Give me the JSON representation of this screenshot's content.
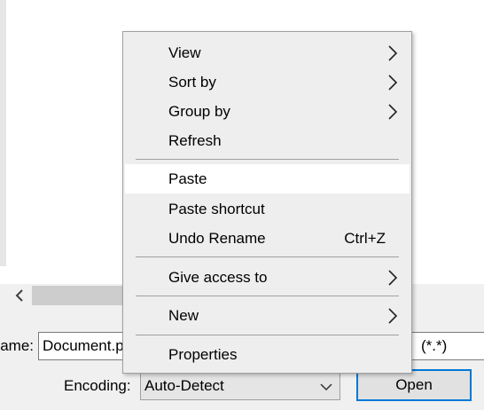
{
  "dialog": {
    "filename_label": "ame:",
    "filename_value": "Document.p",
    "filetype_value": "(*.*)",
    "encoding_label": "Encoding:",
    "encoding_value": "Auto-Detect",
    "open_label": "Open"
  },
  "context_menu": {
    "items": [
      {
        "label": "View",
        "submenu": true
      },
      {
        "label": "Sort by",
        "submenu": true
      },
      {
        "label": "Group by",
        "submenu": true
      },
      {
        "label": "Refresh"
      },
      {
        "label": "Paste",
        "highlighted": true
      },
      {
        "label": "Paste shortcut"
      },
      {
        "label": "Undo Rename",
        "shortcut": "Ctrl+Z"
      },
      {
        "label": "Give access to",
        "submenu": true
      },
      {
        "label": "New",
        "submenu": true
      },
      {
        "label": "Properties"
      }
    ]
  },
  "icons": {
    "submenu": "chevron-right-icon",
    "scroll_left": "chevron-left-icon",
    "dropdown": "chevron-down-icon"
  },
  "colors": {
    "menu_background": "#eeeeee",
    "menu_highlight": "#ffffff",
    "open_button_border": "#0078d7"
  }
}
